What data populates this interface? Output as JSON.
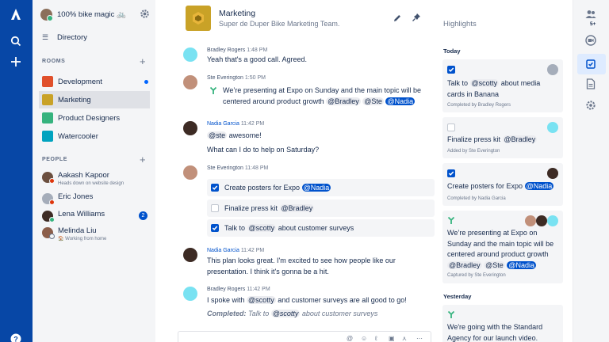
{
  "workspace": {
    "name": "100% bike magic 🚲"
  },
  "sidebar": {
    "directory_label": "Directory",
    "rooms_title": "ROOMS",
    "rooms": [
      {
        "label": "Development",
        "color": "#E0502B",
        "unread": true
      },
      {
        "label": "Marketing",
        "color": "#C9A227",
        "active": true
      },
      {
        "label": "Product Designers",
        "color": "#36B37E"
      },
      {
        "label": "Watercooler",
        "color": "#00A3BF"
      }
    ],
    "people_title": "PEOPLE",
    "people": [
      {
        "name": "Aakash Kapoor",
        "status": "Heads down on website design",
        "presence": "busy",
        "avatar": "#6B4F3F"
      },
      {
        "name": "Eric Jones",
        "status": "",
        "presence": "busy",
        "avatar": "#A5ADBA"
      },
      {
        "name": "Lena Williams",
        "status": "",
        "presence": "on",
        "avatar": "#3D2B24",
        "badge": "2"
      },
      {
        "name": "Melinda Liu",
        "status": "🏠 Working from home",
        "presence": "off",
        "avatar": "#8B5E4A"
      }
    ]
  },
  "room": {
    "title": "Marketing",
    "topic": "Super de Duper Bike Marketing Team."
  },
  "messages": [
    {
      "author": "Bradley Rogers",
      "time": "1:48 PM",
      "text": "Yeah that's a good call. Agreed."
    },
    {
      "author": "Ste Everington",
      "time": "1:50 PM",
      "text_a": "We’re presenting at Expo on Sunday and the main topic will be",
      "text_b": "centered around product growth",
      "mentions": [
        "@Bradley",
        "@Ste",
        "@Nadia"
      ]
    },
    {
      "author": "Nadia Garcia",
      "time": "11:42 PM",
      "mention": "@ste",
      "text_a": "awesome!",
      "text_b": "What can I do to help on Saturday?"
    },
    {
      "author": "Ste Everington",
      "time": "11:48 PM",
      "tasks": [
        {
          "text": "Create posters for Expo",
          "mention": "@Nadia",
          "checked": true
        },
        {
          "text": "Finalize press kit",
          "mention": "@Bradley",
          "checked": false
        },
        {
          "text": "Talk to",
          "mention": "@scotty",
          "text_after": "about customer surveys",
          "checked": true
        }
      ]
    },
    {
      "author": "Nadia Garcia",
      "time": "11:42 PM",
      "text_a": "This plan looks great. I'm excited to see how people like our",
      "text_b": "presentation. I think it's gonna be a hit."
    },
    {
      "author": "Bradley Rogers",
      "time": "11:42 PM",
      "text_a": "I spoke with",
      "mention": "@scotty",
      "text_b": "and customer surveys are all good to go!",
      "completed_label": "Completed:",
      "completed_a": "Talk to",
      "completed_mention": "@scotty",
      "completed_b": "about customer surveys"
    }
  ],
  "highlights": {
    "title": "Highlights",
    "today_label": "Today",
    "yesterday_label": "Yesterday",
    "cards": [
      {
        "text_a": "Talk to",
        "mention": "@scotty",
        "text_b": "about media",
        "text_c": "cards in Banana",
        "meta": "Completed by Bradley Rogers",
        "checked": true
      },
      {
        "text_a": "Finalize press kit",
        "mention": "@Bradley",
        "meta": "Added by Ste Everington",
        "checked": false
      },
      {
        "text_a": "Create posters for Expo",
        "mention": "@Nadia",
        "meta": "Completed by Nadia Garcia",
        "checked": true
      },
      {
        "line1": "We’re presenting at Expo on",
        "line2": "Sunday and the main topic will be",
        "line3": "centered around product growth",
        "mentions": [
          "@Bradley",
          "@Ste",
          "@Nadia"
        ],
        "meta": "Captured by Ste Everington"
      },
      {
        "line1": "We're going with the Standard",
        "line2": "Agency for our launch video."
      }
    ]
  },
  "rail": {
    "people_count": "5+"
  },
  "icons": [
    "atlassian-logo-icon",
    "search-icon",
    "plus-icon",
    "help-icon",
    "gear-icon",
    "directory-icon",
    "pencil-icon",
    "pin-icon",
    "decision-icon",
    "people-icon",
    "video-icon",
    "highlights-icon",
    "files-icon",
    "settings-icon"
  ]
}
